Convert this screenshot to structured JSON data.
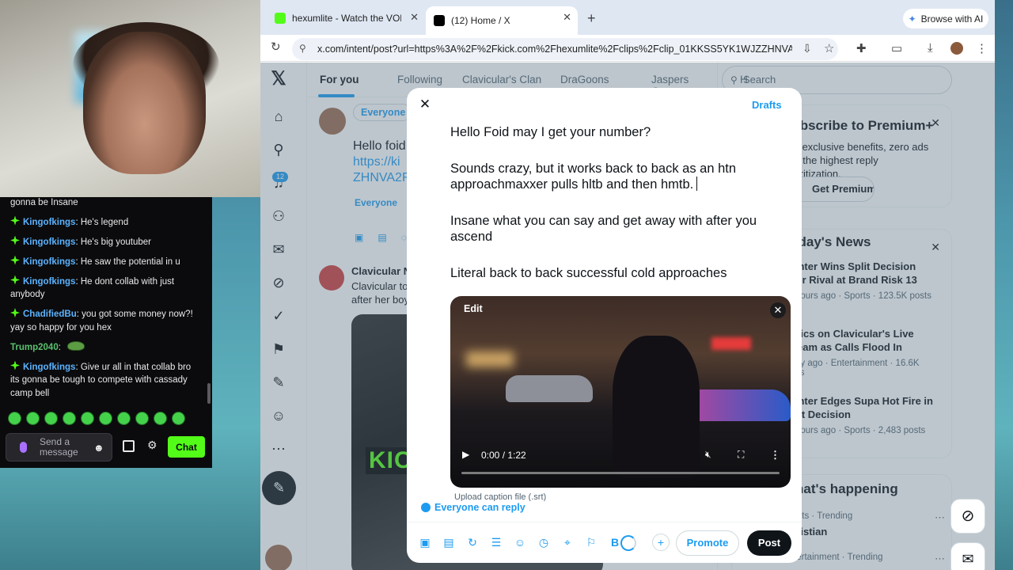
{
  "chat": {
    "messages": [
      {
        "user": "",
        "text": "gonna be Insane",
        "color": ""
      },
      {
        "user": "Kingofkings",
        "text": ": He's legend",
        "color": "#5bb3ff"
      },
      {
        "user": "Kingofkings",
        "text": ": He's big youtuber",
        "color": "#5bb3ff"
      },
      {
        "user": "Kingofkings",
        "text": ": He saw the potential in u",
        "color": "#5bb3ff"
      },
      {
        "user": "Kingofkings",
        "text": ": He dont collab with just anybody",
        "color": "#5bb3ff"
      },
      {
        "user": "ChadifiedBu",
        "text": ": you got some money now?! yay so happy for you hex",
        "color": "#5bb3ff"
      },
      {
        "user": "Trump2040",
        "text": ":",
        "color": "#59c16e"
      },
      {
        "user": "Kingofkings",
        "text": ": Give ur all in that collab bro its gonna be tough to compete with cassady camp bell",
        "color": "#5bb3ff"
      }
    ],
    "placeholder": "Send a message",
    "chat_button": "Chat",
    "accent": "#53fc18"
  },
  "browser": {
    "tabs": [
      {
        "title": "hexumlite - Watch the VOD on Kick"
      },
      {
        "title": "(12) Home / X"
      }
    ],
    "ai_button": "Browse with AI",
    "url": "x.com/intent/post?url=https%3A%2F%2Fkick.com%2Fhexumlite%2Fclips%2Fclip_01KKSS5YK1WJZZHNVA..."
  },
  "x": {
    "notification_count": "12",
    "feed_tabs": [
      "For you",
      "Following",
      "Clavicular's Clan",
      "DraGoons",
      "Jaspers Goons",
      "H"
    ],
    "search_placeholder": "Search",
    "compose_bg": {
      "audience": "Everyone",
      "line1": "Hello foid",
      "link1": "https://ki",
      "link2": "ZHNVA2F",
      "reply": "Everyone"
    },
    "post2": {
      "name": "Clavicular N",
      "text": "Clavicular to after her boy",
      "media_text": "KICK"
    },
    "premium": {
      "title": "Subscribe to Premium+",
      "desc": "Get exclusive benefits, zero ads and the highest reply prioritization.",
      "button": "Get Premium+"
    },
    "news": {
      "title": "Today's News",
      "items": [
        {
          "title": "Fighter Wins Split Decision Over Rival at Brand Risk 13",
          "meta": "14 hours ago · Sports · 123.5K posts"
        },
        {
          "title": "Critics on Clavicular's Live Stream as Calls Flood In",
          "meta": "1 day ago · Entertainment · 16.6K posts"
        },
        {
          "title": "Fighter Edges Supa Hot Fire in Split Decision",
          "meta": "14 hours ago · Sports · 2,483 posts"
        }
      ]
    },
    "happening": {
      "title": "What's happening",
      "t1_meta": "Sports · Trending",
      "t1_name": "Christian",
      "t2_meta": "Entertainment · Trending"
    },
    "accent": "#1d9bf0"
  },
  "modal": {
    "drafts": "Drafts",
    "paragraphs": [
      "Hello Foid may I get your number?",
      "Sounds crazy, but it works back to back as an htn approachmaxxer pulls hltb and then hmtb.",
      "Insane what you can say and get away with after you ascend",
      "Literal back to back successful cold approaches"
    ],
    "video": {
      "edit": "Edit",
      "time": "0:00 / 1:22",
      "progress": 0
    },
    "caption": "Upload caption file (.srt)",
    "reply": "Everyone can reply",
    "promote": "Promote",
    "post": "Post"
  }
}
